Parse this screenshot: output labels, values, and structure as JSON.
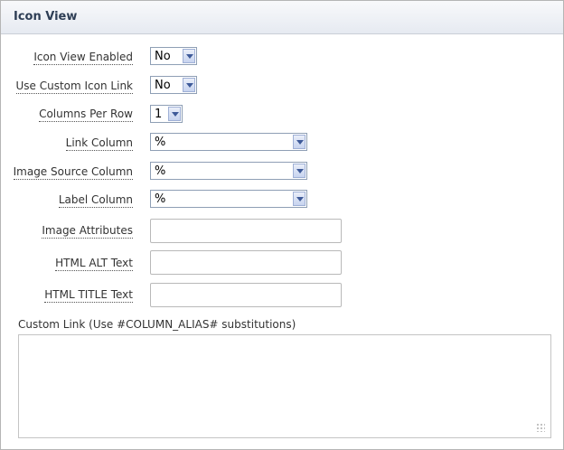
{
  "region": {
    "title": "Icon View"
  },
  "fields": {
    "icon_view_enabled": {
      "label": "Icon View Enabled",
      "value": "No"
    },
    "use_custom_icon_link": {
      "label": "Use Custom Icon Link",
      "value": "No"
    },
    "columns_per_row": {
      "label": "Columns Per Row",
      "value": "1"
    },
    "link_column": {
      "label": "Link Column",
      "value": "%"
    },
    "image_source_column": {
      "label": "Image Source Column",
      "value": "%"
    },
    "label_column": {
      "label": "Label Column",
      "value": "%"
    },
    "image_attributes": {
      "label": "Image Attributes",
      "value": ""
    },
    "html_alt_text": {
      "label": "HTML ALT Text",
      "value": ""
    },
    "html_title_text": {
      "label": "HTML TITLE Text",
      "value": ""
    },
    "custom_link": {
      "label": "Custom Link (Use #COLUMN_ALIAS# substitutions)",
      "value": ""
    }
  }
}
